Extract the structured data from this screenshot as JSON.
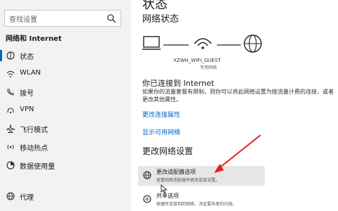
{
  "sidebar": {
    "search_placeholder": "查找设置",
    "section_title": "网络和 Internet",
    "items": [
      {
        "label": "状态",
        "icon": "home-icon"
      },
      {
        "label": "WLAN",
        "icon": "wifi-icon"
      },
      {
        "label": "拨号",
        "icon": "phone-icon"
      },
      {
        "label": "VPN",
        "icon": "vpn-icon"
      },
      {
        "label": "飞行模式",
        "icon": "airplane-icon"
      },
      {
        "label": "移动热点",
        "icon": "hotspot-icon"
      },
      {
        "label": "数据使用量",
        "icon": "data-usage-icon"
      },
      {
        "label": "代理",
        "icon": "globe-icon"
      }
    ]
  },
  "main": {
    "page_title": "状态",
    "network_status": "网络状态",
    "ssid": "XZWH_WIFI_GUEST",
    "network_type": "专用网络",
    "connected_title": "你已连接到 Internet",
    "description": "如果你的流量套餐有限制，则你可以将此网络设置为按流量计费的连接，或者更改其他属性。",
    "link_change_props": "更改连接属性",
    "link_show_networks": "显示可用网络",
    "change_settings_title": "更改网络设置",
    "options": [
      {
        "title": "更改适配器选项",
        "subtitle": "查看网络适配器并更改连接设置。"
      },
      {
        "title": "共享选项",
        "subtitle": "根据所连接到的网络，决定要共享的内容。"
      }
    ]
  },
  "colors": {
    "accent": "#0067c0",
    "annotation_arrow": "#e02020"
  }
}
